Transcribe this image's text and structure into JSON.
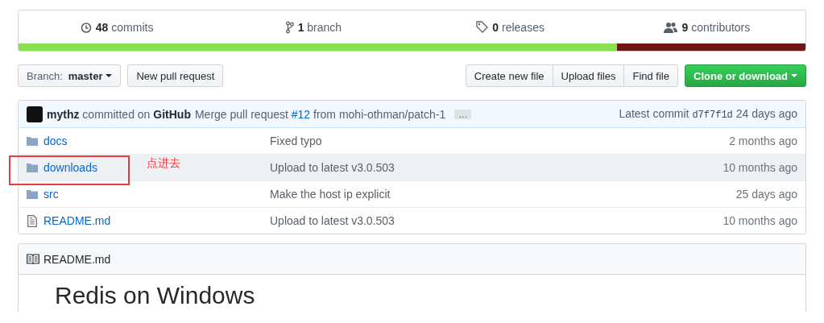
{
  "summary": {
    "stats": [
      {
        "kind": "commits",
        "count": "48",
        "label": "commits"
      },
      {
        "kind": "branches",
        "count": "1",
        "label": "branch"
      },
      {
        "kind": "releases",
        "count": "0",
        "label": "releases"
      },
      {
        "kind": "contributors",
        "count": "9",
        "label": "contributors"
      }
    ],
    "language_bar": [
      {
        "color": "#89e051",
        "level": 0.76
      },
      {
        "color": "#701516",
        "level": 0.24
      }
    ]
  },
  "toolbar": {
    "branch_prefix": "Branch:",
    "branch": "master",
    "new_pull_request": "New pull request",
    "file_buttons": [
      "Create new file",
      "Upload files",
      "Find file"
    ],
    "clone_button": "Clone or download"
  },
  "commit_bar": {
    "author": "mythz",
    "committed_on": "committed on",
    "committer": "GitHub",
    "message": "Merge pull request",
    "pr_link": "#12",
    "message_end": "from mohi-othman/patch-1",
    "ellipsis": "…",
    "latest_label": "Latest commit",
    "sha": "d7f7f1d",
    "age": "24 days ago"
  },
  "files": [
    {
      "kind": "folder",
      "name": "docs",
      "message": "Fixed typo",
      "age": "2 months ago",
      "hovered": false
    },
    {
      "kind": "folder",
      "name": "downloads",
      "message": "Upload to latest v3.0.503",
      "age": "10 months ago",
      "hovered": true
    },
    {
      "kind": "folder",
      "name": "src",
      "message": "Make the host ip explicit",
      "age": "25 days ago",
      "hovered": false
    },
    {
      "kind": "file",
      "name": "README.md",
      "message": "Upload to latest v3.0.503",
      "age": "10 months ago",
      "hovered": false
    }
  ],
  "annotation": {
    "text": "点进去"
  },
  "readme": {
    "filename": "README.md",
    "heading": "Redis on Windows"
  }
}
